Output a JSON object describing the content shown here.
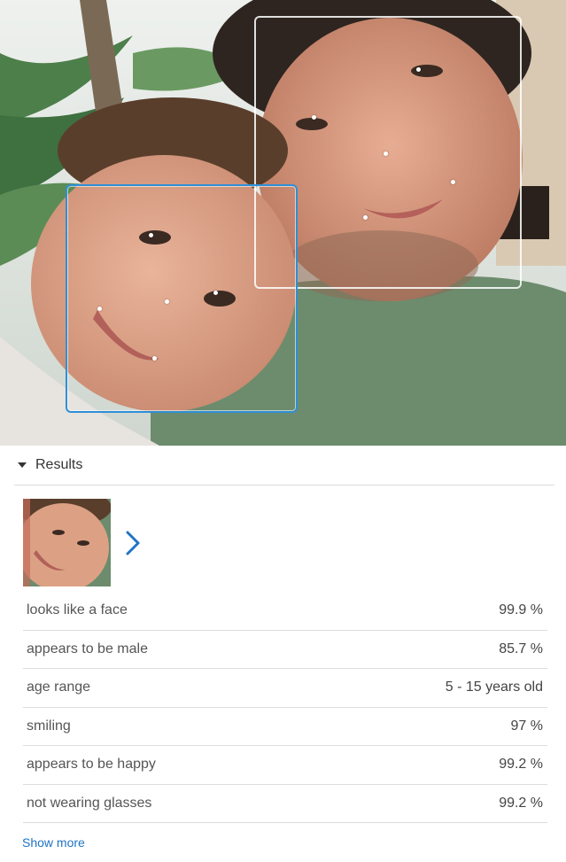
{
  "results": {
    "title": "Results",
    "toggle_icon": "caret-down-icon",
    "next_icon": "chevron-right-icon",
    "attributes": [
      {
        "label": "looks like a face",
        "value": "99.9 %"
      },
      {
        "label": "appears to be male",
        "value": "85.7 %"
      },
      {
        "label": "age range",
        "value": "5 - 15 years old"
      },
      {
        "label": "smiling",
        "value": "97 %"
      },
      {
        "label": "appears to be happy",
        "value": "99.2 %"
      },
      {
        "label": "not wearing glasses",
        "value": "99.2 %"
      }
    ],
    "show_more": "Show more"
  },
  "colors": {
    "selected_box": "#2f8fd6",
    "other_box": "#ffffff",
    "link": "#1f74c4",
    "arrow": "#1f74c4"
  }
}
